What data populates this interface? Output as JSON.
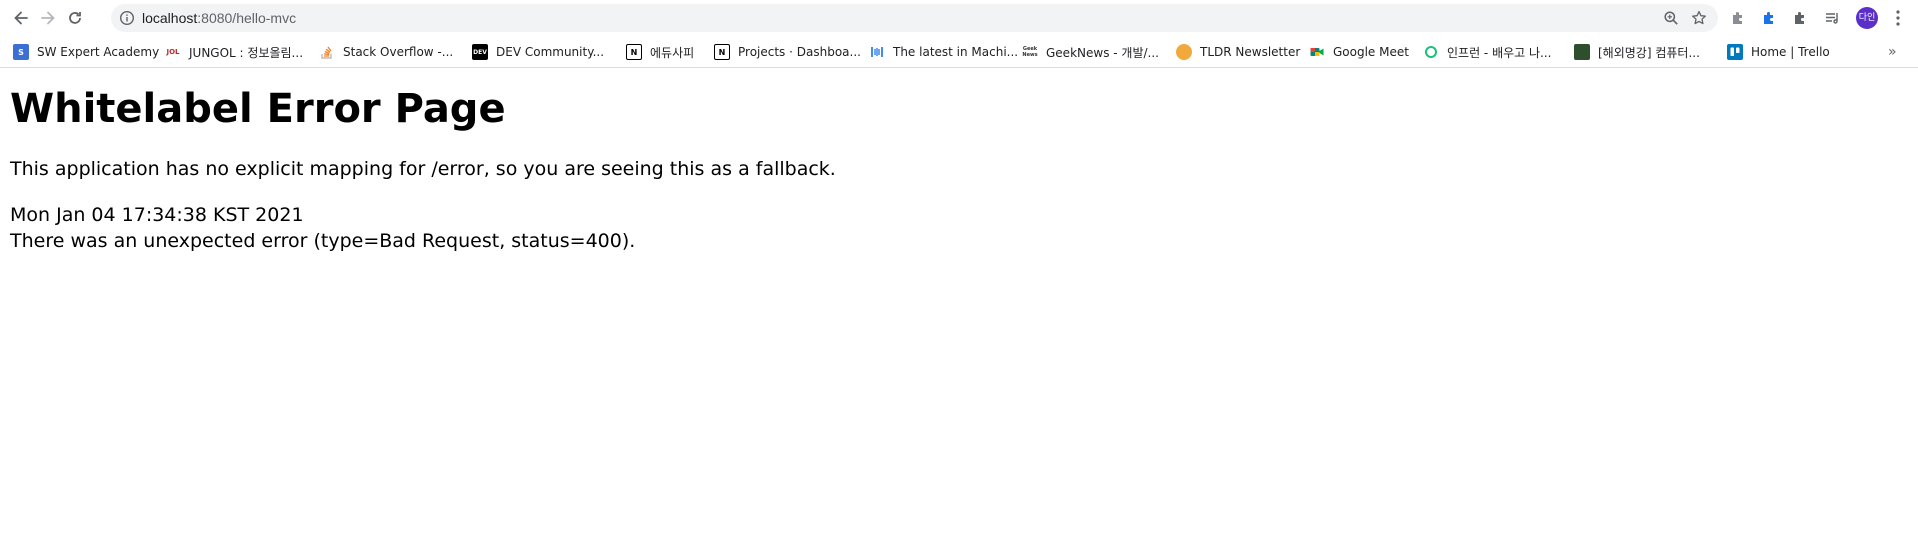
{
  "browser": {
    "url_host": "localhost",
    "url_rest": ":8080/hello-mvc",
    "avatar_text": "다인"
  },
  "bookmarks": [
    {
      "label": "SW Expert Academy",
      "icon": "swea-icon",
      "color": "#3b6fd6"
    },
    {
      "label": "JUNGOL : 정보올림...",
      "icon": "jungol-icon",
      "color": "#b32f2f"
    },
    {
      "label": "Stack Overflow -...",
      "icon": "stackoverflow-icon",
      "color": "#f48024"
    },
    {
      "label": "DEV Community...",
      "icon": "dev-icon",
      "color": "#000000"
    },
    {
      "label": "에듀사피",
      "icon": "notion-icon",
      "color": "#000000"
    },
    {
      "label": "Projects · Dashboa...",
      "icon": "notion-icon",
      "color": "#000000"
    },
    {
      "label": "The latest in Machi...",
      "icon": "paperswithcode-icon",
      "color": "#2f80ed"
    },
    {
      "label": "GeekNews - 개발/...",
      "icon": "geeknews-icon",
      "color": "#ffffff"
    },
    {
      "label": "TLDR Newsletter",
      "icon": "tldr-icon",
      "color": "#f2a93b"
    },
    {
      "label": "Google Meet",
      "icon": "google-meet-icon",
      "color": "#00897b"
    },
    {
      "label": "인프런 - 배우고 나...",
      "icon": "inflearn-icon",
      "color": "#1dc078"
    },
    {
      "label": "[해외명강] 컴퓨터...",
      "icon": "kocw-icon",
      "color": "#2e4f2e"
    },
    {
      "label": "Home | Trello",
      "icon": "trello-icon",
      "color": "#0079bf"
    }
  ],
  "page": {
    "title": "Whitelabel Error Page",
    "message": "This application has no explicit mapping for /error, so you are seeing this as a fallback.",
    "timestamp": "Mon Jan 04 17:34:38 KST 2021",
    "error_detail": "There was an unexpected error (type=Bad Request, status=400)."
  }
}
